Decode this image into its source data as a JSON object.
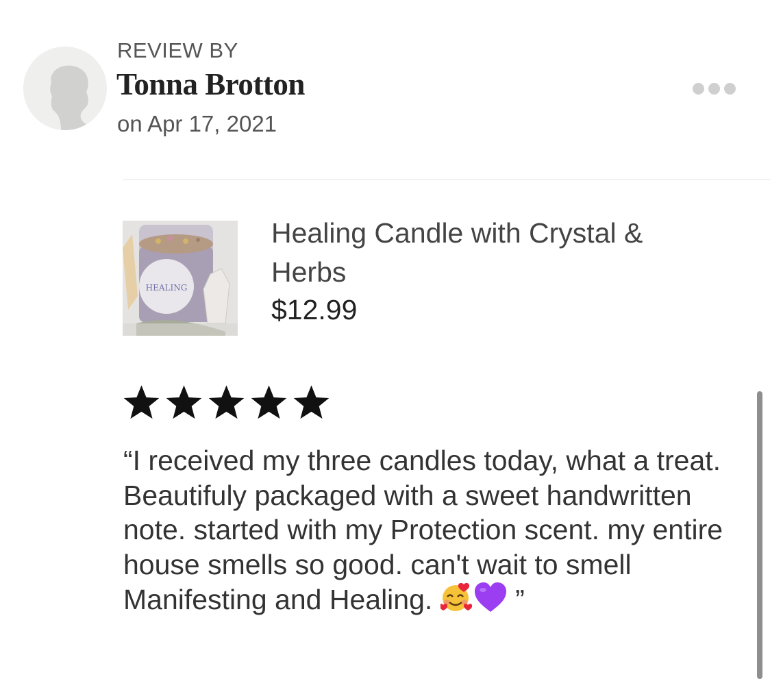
{
  "reviewer": {
    "review_by_label": "REVIEW BY",
    "name": "Tonna Brotton",
    "date": "on Apr 17, 2021",
    "avatar_icon": "default-user-silhouette"
  },
  "menu": {
    "icon": "more-horizontal-icon"
  },
  "product": {
    "title": "Healing Candle with Crystal & Herbs",
    "price": "$12.99",
    "label_text": "HEALING"
  },
  "rating": {
    "stars": 5,
    "max": 5,
    "star_color": "#111111"
  },
  "review": {
    "text": "“I received my three candles today, what a treat. Beautifuly packaged with a sweet handwritten note. started with my Protection scent. my entire house smells so good. can't wait to smell  Manifesting and Healing.",
    "closing": " ”",
    "emojis": [
      "smiling-face-with-hearts",
      "purple-heart"
    ]
  },
  "colors": {
    "background": "#ffffff",
    "divider": "#e2e2e2",
    "dots": "#cfcfcf",
    "scrollbar": "#8e8e8e"
  }
}
